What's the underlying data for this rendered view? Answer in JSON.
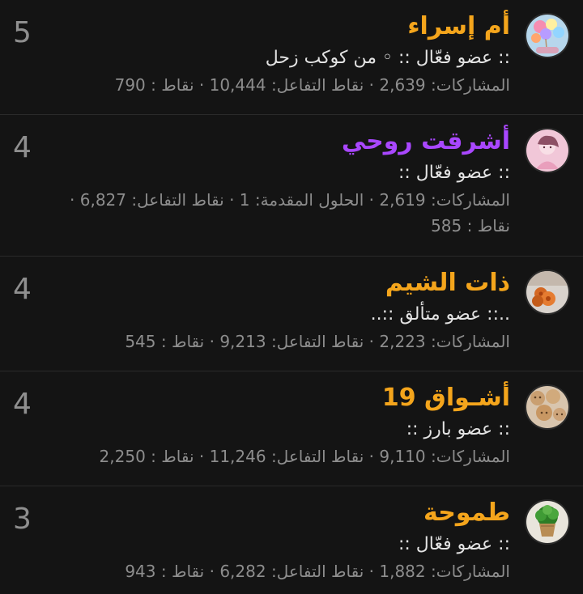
{
  "members": [
    {
      "score": "5",
      "name": "أم إسراء",
      "name_color": "orange",
      "title": ":: عضو فعّال :: ◦ من كوكب زحل",
      "stats_line1": "المشاركات: 2,639 · نقاط التفاعل: 10,444 · نقاط : 790",
      "stats_line2": "",
      "avatar": "balloons-avatar"
    },
    {
      "score": "4",
      "name": "أشرقت روحي",
      "name_color": "purple",
      "title": ":: عضو فعّال ::",
      "stats_line1": "المشاركات: 2,619 · الحلول المقدمة: 1 · نقاط التفاعل: 6,827 ·",
      "stats_line2": "نقاط : 585",
      "avatar": "pink-girl-avatar"
    },
    {
      "score": "4",
      "name": "ذات الشيم",
      "name_color": "orange",
      "title": "..:: عضو متألق ::..",
      "stats_line1": "المشاركات: 2,223 · نقاط التفاعل: 9,213 · نقاط : 545",
      "stats_line2": "",
      "avatar": "flowers-avatar"
    },
    {
      "score": "4",
      "name": "أشـواق 19",
      "name_color": "orange",
      "title": ":: عضو بارز ::",
      "stats_line1": "المشاركات: 9,110 · نقاط التفاعل: 11,246 · نقاط : 2,250",
      "stats_line2": "",
      "avatar": "wooden-faces-avatar"
    },
    {
      "score": "3",
      "name": "طموحة",
      "name_color": "orange",
      "title": ":: عضو فعّال ::",
      "stats_line1": "المشاركات: 1,882 · نقاط التفاعل: 6,282 · نقاط : 943",
      "stats_line2": "",
      "avatar": "plant-pot-avatar"
    }
  ],
  "colors": {
    "background": "#141414",
    "name_orange": "#f4a51c",
    "name_purple": "#a947ff",
    "score_gray": "#8f8f8f",
    "stats_gray": "#8d8d8d",
    "divider": "#2a2a2a"
  }
}
